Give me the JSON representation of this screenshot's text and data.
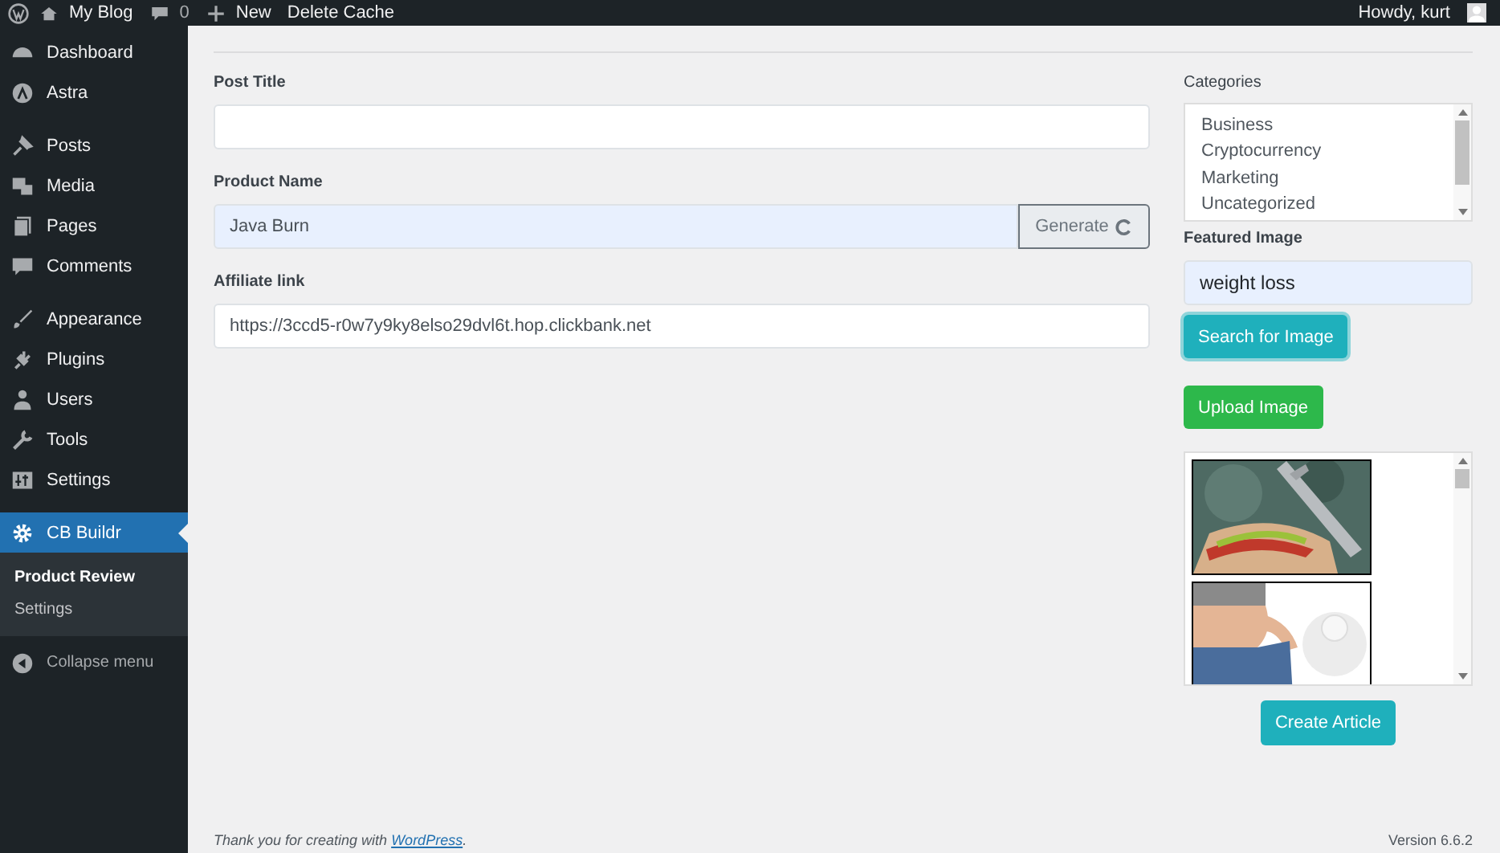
{
  "admin_bar": {
    "site": "My Blog",
    "comments": "0",
    "new": "New",
    "delete_cache": "Delete Cache",
    "greeting": "Howdy, kurt"
  },
  "sidebar": {
    "groups": [
      [
        {
          "label": "Dashboard"
        },
        {
          "label": "Astra"
        }
      ],
      [
        {
          "label": "Posts"
        },
        {
          "label": "Media"
        },
        {
          "label": "Pages"
        },
        {
          "label": "Comments"
        }
      ],
      [
        {
          "label": "Appearance"
        },
        {
          "label": "Plugins"
        },
        {
          "label": "Users"
        },
        {
          "label": "Tools"
        },
        {
          "label": "Settings"
        }
      ]
    ],
    "current": {
      "label": "CB Buildr",
      "children": [
        {
          "label": "Product Review",
          "selected": true
        },
        {
          "label": "Settings",
          "selected": false
        }
      ]
    },
    "collapse": "Collapse menu"
  },
  "form": {
    "post_title": {
      "label": "Post Title"
    },
    "product_name": {
      "label": "Product Name",
      "value": "Java Burn",
      "button": "Generate"
    },
    "affiliate_link": {
      "label": "Affiliate link",
      "value": "https://3ccd5-r0w7y9ky8elso29dvl6t.hop.clickbank.net"
    }
  },
  "categories": {
    "label": "Categories",
    "items": [
      "Business",
      "Cryptocurrency",
      "Marketing",
      "Uncategorized"
    ]
  },
  "featured_image": {
    "label": "Featured Image",
    "value": "weight loss",
    "search_button": "Search for Image",
    "upload_button": "Upload Image"
  },
  "create_button": "Create Article",
  "footer": {
    "text": "Thank you for creating with ",
    "link": "WordPress",
    "after": ".",
    "version": "Version 6.6.2"
  }
}
